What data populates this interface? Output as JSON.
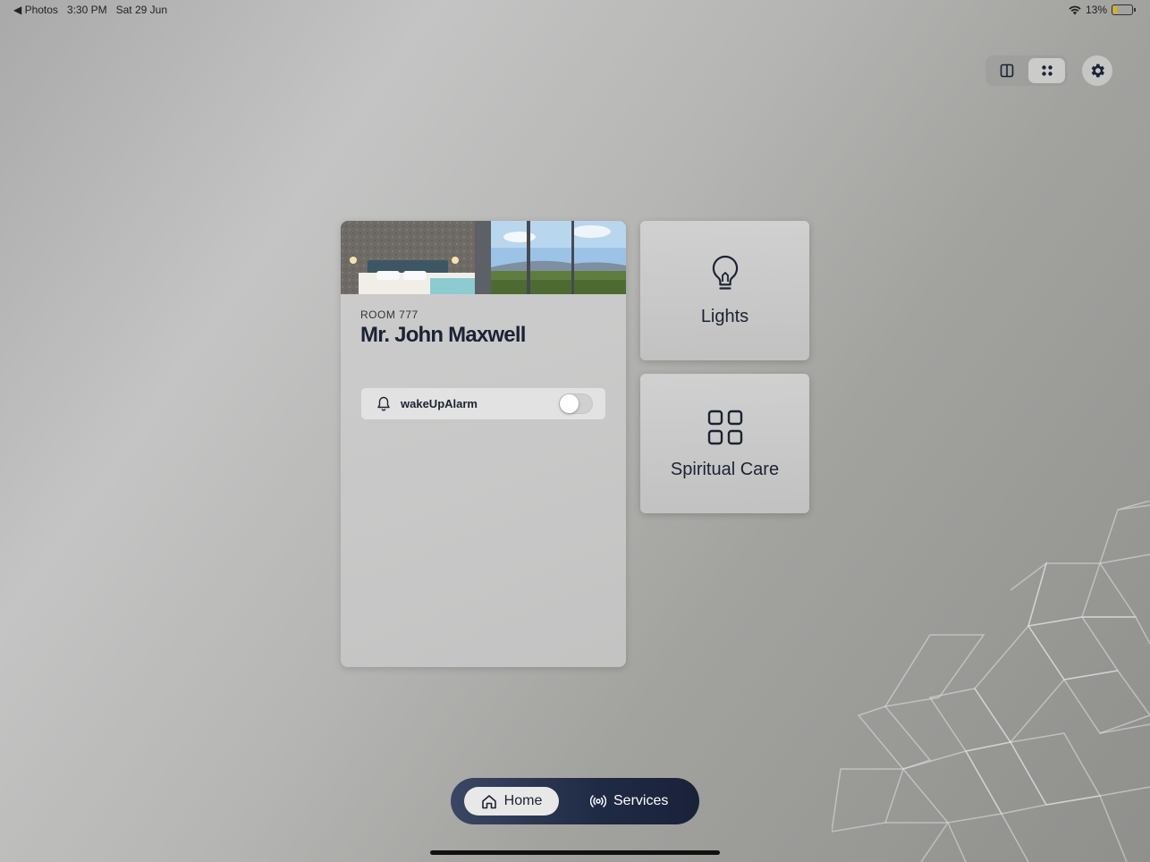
{
  "status_bar": {
    "back_app": "◀ Photos",
    "time": "3:30 PM",
    "date": "Sat 29 Jun",
    "battery": "13%"
  },
  "toolbar": {
    "layout_split_icon": "split-view-icon",
    "layout_grid_icon": "grid-view-icon",
    "settings_icon": "gear-icon"
  },
  "profile": {
    "room_label": "ROOM 777",
    "guest_name": "Mr. John Maxwell",
    "alarm": {
      "label": "wakeUpAlarm",
      "enabled": false
    }
  },
  "tiles": [
    {
      "label": "Lights",
      "icon": "lightbulb-icon"
    },
    {
      "label": "Spiritual Care",
      "icon": "grid-squares-icon"
    }
  ],
  "bottom_nav": {
    "home_label": "Home",
    "services_label": "Services"
  },
  "colors": {
    "nav_dark": "#1f2a44",
    "text_dark": "#1b2233"
  }
}
